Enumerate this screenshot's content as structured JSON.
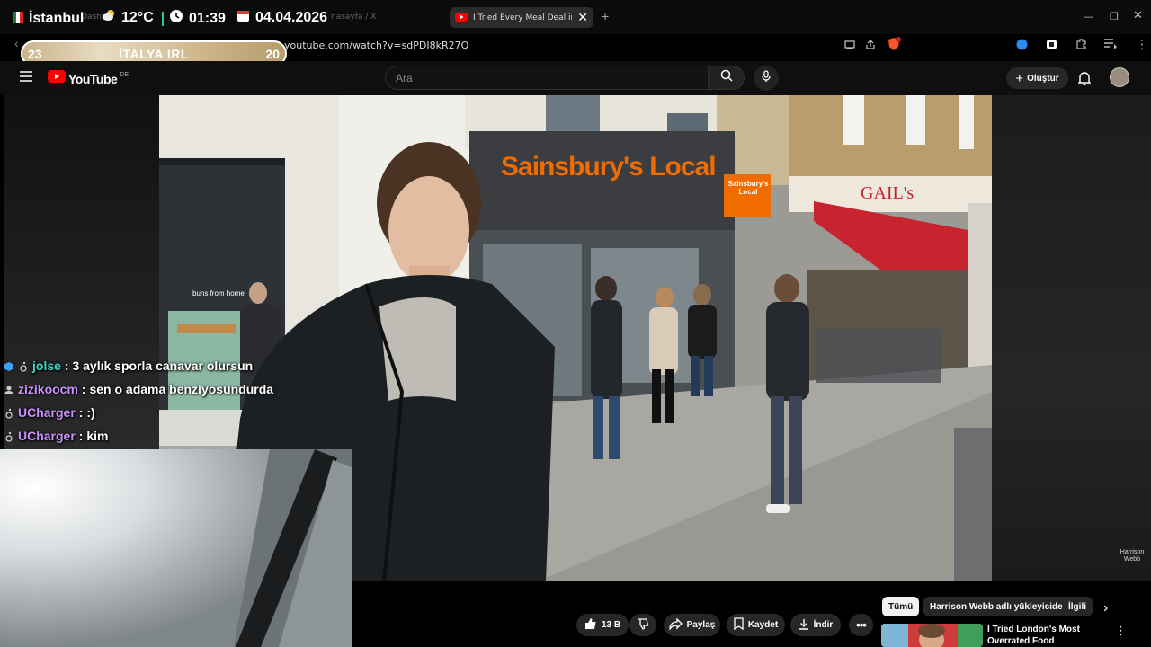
{
  "stream_overlay": {
    "city": "İstanbul",
    "temperature": "12°C",
    "time": "01:39",
    "date": "04.04.2026",
    "ghost_tab_text": "nasayfa / X",
    "ghost_left_text": "Dashb"
  },
  "score": {
    "left": "23",
    "title": "İTALYA IRL",
    "right": "20"
  },
  "browser": {
    "tab_title": "I Tried Every Meal Deal in th",
    "url": "youtube.com/watch?v=sdPDI8kR27Q",
    "brave_badge": "4"
  },
  "youtube": {
    "logo_text": "YouTube",
    "region": "DE",
    "search_placeholder": "Ara",
    "create_label": "Oluştur"
  },
  "chat": [
    {
      "user": "jolse",
      "message": ": 3 aylık sporla canavar olursun",
      "user_color": "#3fd3c2"
    },
    {
      "user": "zizikoocm",
      "message": ": sen o adama benziyosundurda",
      "user_color": "#c992ff"
    },
    {
      "user": "UCharger",
      "message": ": :)",
      "user_color": "#c992ff"
    },
    {
      "user": "UCharger",
      "message": ": kim",
      "user_color": "#c992ff"
    }
  ],
  "video": {
    "shop_sign": "Sainsbury's Local",
    "shop_sign_small": "Sainsbury's Local",
    "gails_sign": "GAIL's",
    "buns_sign": "buns from home",
    "watermark": "Harrison Webb"
  },
  "actions": {
    "like_count": "13 B",
    "share_label": "Paylaş",
    "save_label": "Kaydet",
    "download_label": "İndir"
  },
  "chips": [
    "Tümü",
    "Harrison Webb adlı yükleyiciden",
    "İlgili"
  ],
  "recommendation": {
    "title": "I Tried London's Most Overrated Food"
  },
  "colors": {
    "yt_red": "#ff0000",
    "gold": "#c9b38a",
    "awning_red": "#c8242f",
    "sainsbury_orange": "#f06c00"
  }
}
